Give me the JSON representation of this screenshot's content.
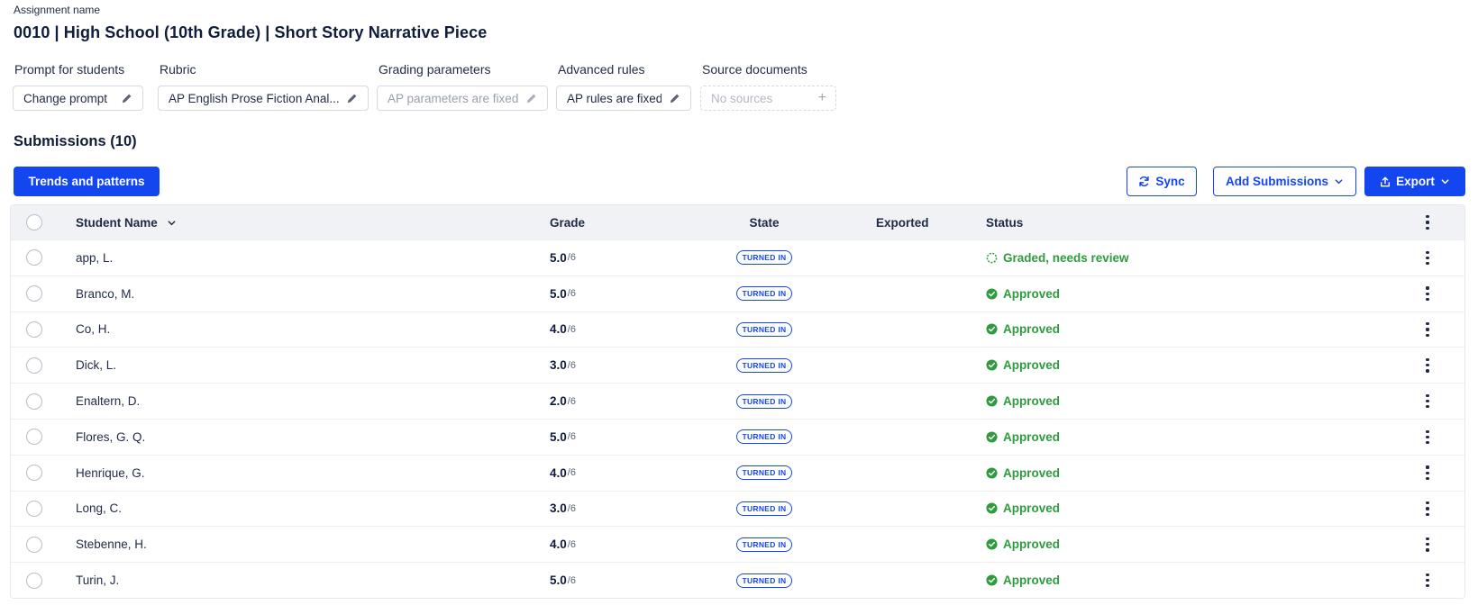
{
  "assignment": {
    "label": "Assignment name",
    "title": "0010 | High School (10th Grade) | Short Story Narrative Piece"
  },
  "fields": [
    {
      "label": "Prompt for students",
      "value": "Change prompt",
      "icon": "pencil-icon"
    },
    {
      "label": "Rubric",
      "value": "AP English Prose Fiction Anal...",
      "icon": "pencil-icon"
    },
    {
      "label": "Grading parameters",
      "value": "AP parameters are fixed",
      "icon": "pencil-icon"
    },
    {
      "label": "Advanced rules",
      "value": "AP rules are fixed",
      "icon": "pencil-icon"
    },
    {
      "label": "Source documents",
      "value": "No sources",
      "icon": "plus-icon"
    }
  ],
  "submissions": {
    "title": "Submissions (10)",
    "trends_label": "Trends and patterns",
    "sync_label": "Sync",
    "add_label": "Add Submissions",
    "export_label": "Export"
  },
  "table": {
    "columns": {
      "student": "Student Name",
      "grade": "Grade",
      "state": "State",
      "exported": "Exported",
      "status": "Status"
    },
    "rows": [
      {
        "name": "app, L.",
        "grade": "5.0",
        "max": "/6",
        "state": "TURNED IN",
        "status": "Graded, needs review",
        "status_type": "review"
      },
      {
        "name": "Branco, M.",
        "grade": "5.0",
        "max": "/6",
        "state": "TURNED IN",
        "status": "Approved",
        "status_type": "approved"
      },
      {
        "name": "Co, H.",
        "grade": "4.0",
        "max": "/6",
        "state": "TURNED IN",
        "status": "Approved",
        "status_type": "approved"
      },
      {
        "name": "Dick, L.",
        "grade": "3.0",
        "max": "/6",
        "state": "TURNED IN",
        "status": "Approved",
        "status_type": "approved"
      },
      {
        "name": "Enaltern, D.",
        "grade": "2.0",
        "max": "/6",
        "state": "TURNED IN",
        "status": "Approved",
        "status_type": "approved"
      },
      {
        "name": "Flores, G. Q.",
        "grade": "5.0",
        "max": "/6",
        "state": "TURNED IN",
        "status": "Approved",
        "status_type": "approved"
      },
      {
        "name": "Henrique, G.",
        "grade": "4.0",
        "max": "/6",
        "state": "TURNED IN",
        "status": "Approved",
        "status_type": "approved"
      },
      {
        "name": "Long, C.",
        "grade": "3.0",
        "max": "/6",
        "state": "TURNED IN",
        "status": "Approved",
        "status_type": "approved"
      },
      {
        "name": "Stebenne, H.",
        "grade": "4.0",
        "max": "/6",
        "state": "TURNED IN",
        "status": "Approved",
        "status_type": "approved"
      },
      {
        "name": "Turin, J.",
        "grade": "5.0",
        "max": "/6",
        "state": "TURNED IN",
        "status": "Approved",
        "status_type": "approved"
      }
    ]
  },
  "colors": {
    "primary": "#1446f0",
    "approved": "#2e9b3e",
    "title": "#0f1c3a"
  }
}
